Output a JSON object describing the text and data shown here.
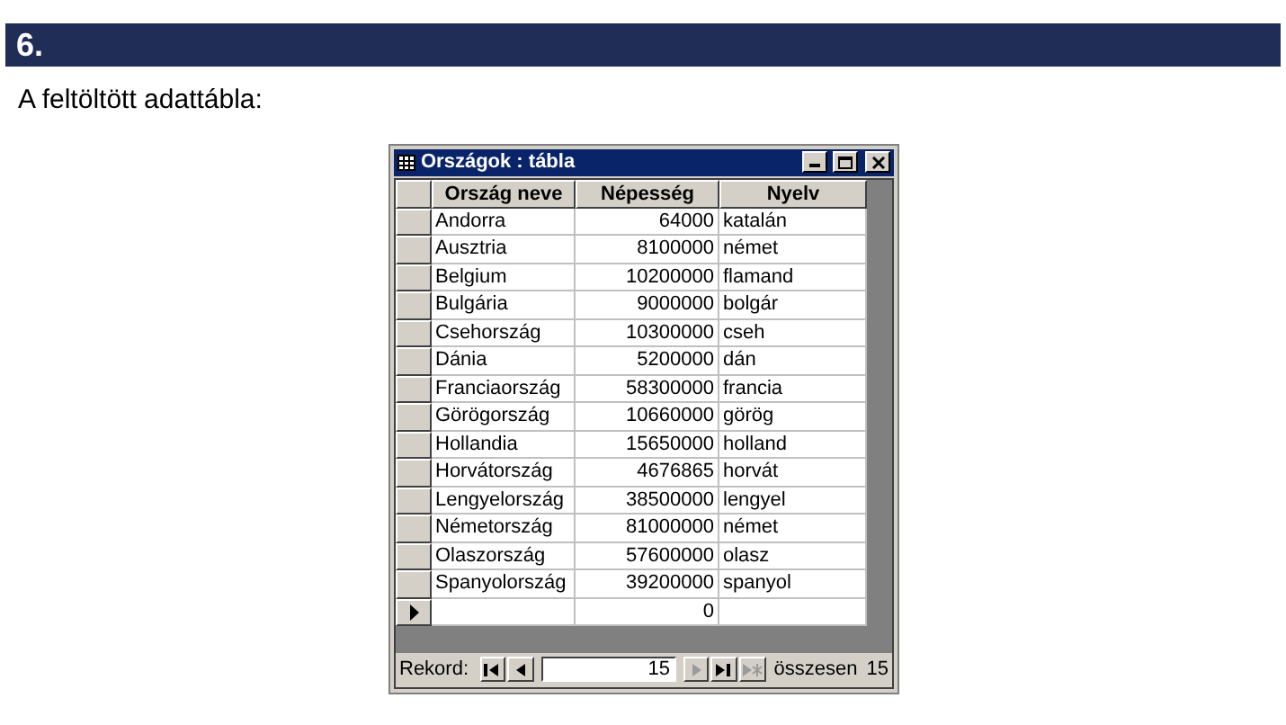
{
  "heading": "6.",
  "intro": "A feltöltött adattábla:",
  "window": {
    "title": "Országok : tábla",
    "table": {
      "columns": [
        "Ország neve",
        "Népesség",
        "Nyelv"
      ],
      "rows": [
        {
          "cells": [
            "Andorra",
            "64000",
            "katalán"
          ],
          "current": false
        },
        {
          "cells": [
            "Ausztria",
            "8100000",
            "német"
          ],
          "current": false
        },
        {
          "cells": [
            "Belgium",
            "10200000",
            "flamand"
          ],
          "current": false
        },
        {
          "cells": [
            "Bulgária",
            "9000000",
            "bolgár"
          ],
          "current": false
        },
        {
          "cells": [
            "Csehország",
            "10300000",
            "cseh"
          ],
          "current": false
        },
        {
          "cells": [
            "Dánia",
            "5200000",
            "dán"
          ],
          "current": false
        },
        {
          "cells": [
            "Franciaország",
            "58300000",
            "francia"
          ],
          "current": false
        },
        {
          "cells": [
            "Görögország",
            "10660000",
            "görög"
          ],
          "current": false
        },
        {
          "cells": [
            "Hollandia",
            "15650000",
            "holland"
          ],
          "current": false
        },
        {
          "cells": [
            "Horvátország",
            "4676865",
            "horvát"
          ],
          "current": false
        },
        {
          "cells": [
            "Lengyelország",
            "38500000",
            "lengyel"
          ],
          "current": false
        },
        {
          "cells": [
            "Németország",
            "81000000",
            "német"
          ],
          "current": false
        },
        {
          "cells": [
            "Olaszország",
            "57600000",
            "olasz"
          ],
          "current": false
        },
        {
          "cells": [
            "Spanyolország",
            "39200000",
            "spanyol"
          ],
          "current": false
        },
        {
          "cells": [
            "",
            "0",
            ""
          ],
          "current": true
        }
      ]
    },
    "navigator": {
      "label": "Rekord:",
      "record": "15",
      "total_label": "összesen",
      "total": "15",
      "buttons_before": [
        {
          "kind": "first",
          "disabled": false
        },
        {
          "kind": "prev",
          "disabled": false
        }
      ],
      "buttons_after": [
        {
          "kind": "next",
          "disabled": true
        },
        {
          "kind": "last",
          "disabled": false
        },
        {
          "kind": "new",
          "disabled": true
        }
      ]
    }
  }
}
